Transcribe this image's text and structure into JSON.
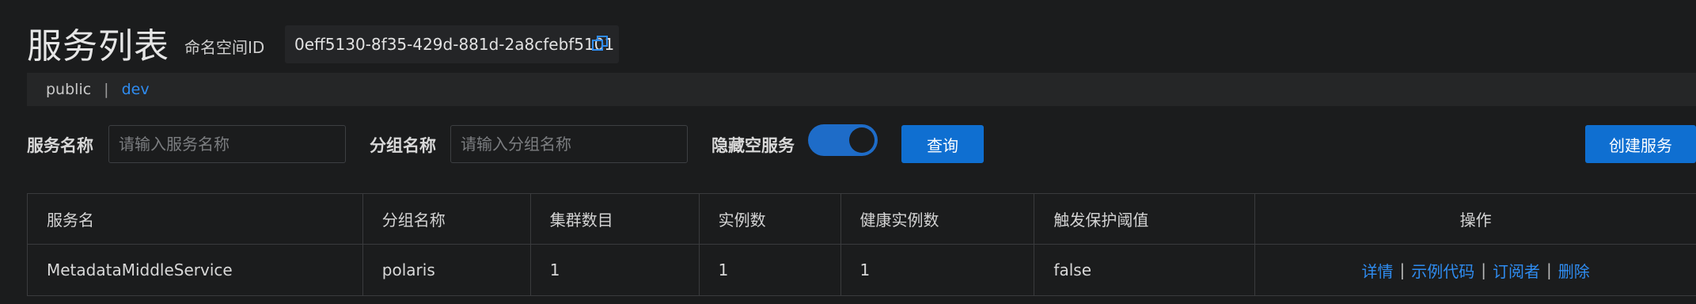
{
  "header": {
    "title": "服务列表",
    "namespace_label": "命名空间ID",
    "namespace_id": "0eff5130-8f35-429d-881d-2a8cfebf5101"
  },
  "namespaces": {
    "tabs": [
      {
        "label": "public",
        "active": false
      },
      {
        "label": "dev",
        "active": true
      }
    ],
    "separator": "|"
  },
  "filters": {
    "service_name_label": "服务名称",
    "service_name_placeholder": "请输入服务名称",
    "group_name_label": "分组名称",
    "group_name_placeholder": "请输入分组名称",
    "hide_empty_label": "隐藏空服务",
    "hide_empty_enabled": true,
    "query_button": "查询",
    "create_button": "创建服务"
  },
  "table": {
    "columns": [
      "服务名",
      "分组名称",
      "集群数目",
      "实例数",
      "健康实例数",
      "触发保护阈值",
      "操作"
    ],
    "rows": [
      {
        "service": "MetadataMiddleService",
        "group": "polaris",
        "clusters": "1",
        "instances": "1",
        "healthy": "1",
        "protect": "false",
        "actions": [
          "详情",
          "示例代码",
          "订阅者",
          "删除"
        ]
      }
    ],
    "action_separator": "|"
  },
  "colors": {
    "background": "#1b1c1d",
    "accent": "#0f6fd1",
    "link": "#2f8cf0"
  },
  "icons": {
    "copy": "copy-icon"
  }
}
